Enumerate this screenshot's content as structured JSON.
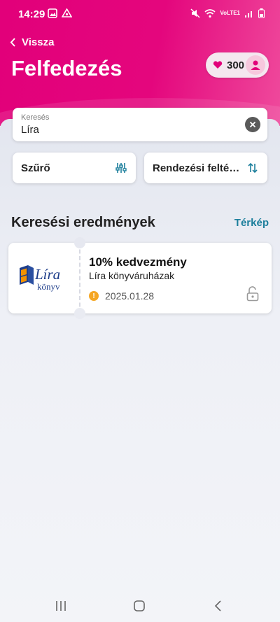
{
  "status": {
    "time": "14:29",
    "volte": "VoLTE1"
  },
  "header": {
    "back_label": "Vissza",
    "title": "Felfedezés",
    "points": "300"
  },
  "search": {
    "label": "Keresés",
    "value": "Líra"
  },
  "filters": {
    "filter_label": "Szűrő",
    "sort_label": "Rendezési feltételek"
  },
  "results": {
    "title": "Keresési eredmények",
    "map_link": "Térkép",
    "items": [
      {
        "offer": "10% kedvezmény",
        "store": "Líra könyváruházak",
        "date": "2025.01.28",
        "logo_text": "Líra",
        "logo_sub": "könyv"
      }
    ]
  },
  "colors": {
    "brand": "#e2007a",
    "link": "#1d7f9c",
    "warning": "#f5a623"
  }
}
